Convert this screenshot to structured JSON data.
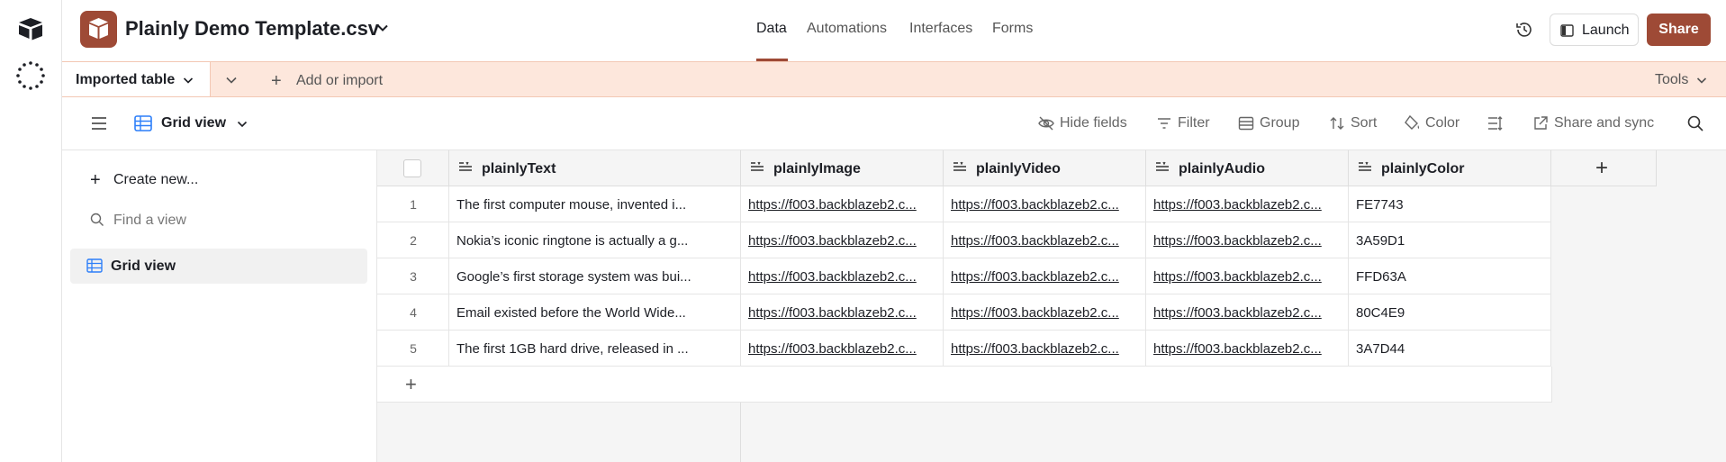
{
  "app": {
    "base_title": "Plainly Demo Template.csv"
  },
  "nav": {
    "tabs": [
      {
        "label": "Data",
        "active": true
      },
      {
        "label": "Automations",
        "active": false
      },
      {
        "label": "Interfaces",
        "active": false
      },
      {
        "label": "Forms",
        "active": false
      }
    ]
  },
  "header_actions": {
    "launch_label": "Launch",
    "share_label": "Share"
  },
  "tablebar": {
    "table_name": "Imported table",
    "add_import_label": "Add or import",
    "tools_label": "Tools"
  },
  "viewbar": {
    "view_name": "Grid view",
    "hide_fields": "Hide fields",
    "filter": "Filter",
    "group": "Group",
    "sort": "Sort",
    "color": "Color",
    "share_sync": "Share and sync"
  },
  "sidebar": {
    "create_new": "Create new...",
    "find_placeholder": "Find a view",
    "views": [
      {
        "label": "Grid view"
      }
    ]
  },
  "grid": {
    "columns": [
      "plainlyText",
      "plainlyImage",
      "plainlyVideo",
      "plainlyAudio",
      "plainlyColor"
    ],
    "rows": [
      {
        "num": "1",
        "text": "The first computer mouse, invented i...",
        "image": "https://f003.backblazeb2.c...",
        "video": "https://f003.backblazeb2.c...",
        "audio": "https://f003.backblazeb2.c...",
        "color": "FE7743"
      },
      {
        "num": "2",
        "text": "Nokia’s iconic ringtone is actually a g...",
        "image": "https://f003.backblazeb2.c...",
        "video": "https://f003.backblazeb2.c...",
        "audio": "https://f003.backblazeb2.c...",
        "color": "3A59D1"
      },
      {
        "num": "3",
        "text": "Google’s first storage system was bui...",
        "image": "https://f003.backblazeb2.c...",
        "video": "https://f003.backblazeb2.c...",
        "audio": "https://f003.backblazeb2.c...",
        "color": "FFD63A"
      },
      {
        "num": "4",
        "text": "Email existed before the World Wide...",
        "image": "https://f003.backblazeb2.c...",
        "video": "https://f003.backblazeb2.c...",
        "audio": "https://f003.backblazeb2.c...",
        "color": "80C4E9"
      },
      {
        "num": "5",
        "text": "The first 1GB hard drive, released in ...",
        "image": "https://f003.backblazeb2.c...",
        "video": "https://f003.backblazeb2.c...",
        "audio": "https://f003.backblazeb2.c...",
        "color": "3A7D44"
      }
    ]
  },
  "colors": {
    "brand": "#9e4a36",
    "table_strip": "#fde7dc"
  }
}
